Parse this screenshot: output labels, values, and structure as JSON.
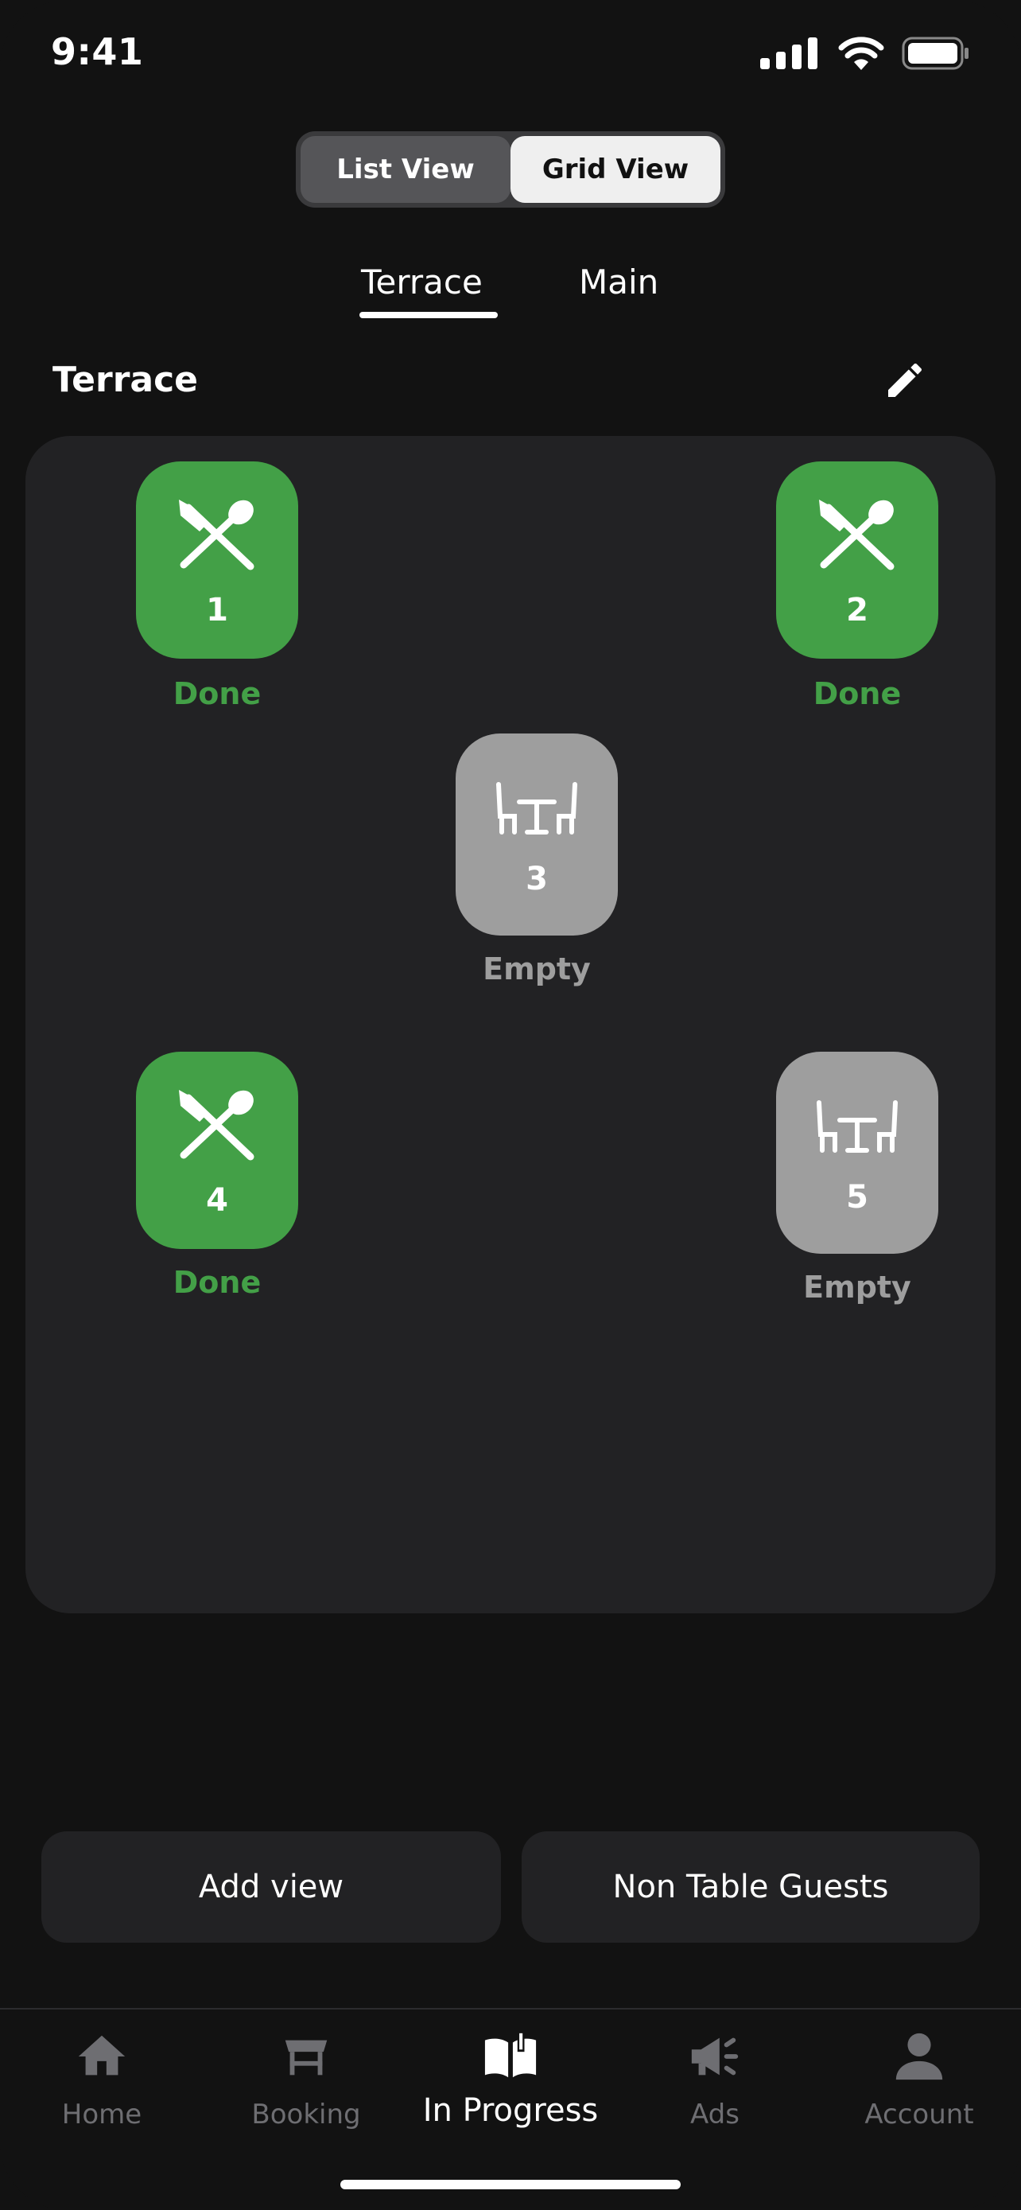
{
  "status_bar": {
    "time": "9:41"
  },
  "view_toggle": {
    "list_label": "List View",
    "grid_label": "Grid View",
    "selected": "Grid View"
  },
  "tabs": [
    {
      "label": "Terrace",
      "active": true
    },
    {
      "label": "Main",
      "active": false
    }
  ],
  "section": {
    "title": "Terrace"
  },
  "tables": [
    {
      "number": "1",
      "status": "Done",
      "state": "done"
    },
    {
      "number": "2",
      "status": "Done",
      "state": "done"
    },
    {
      "number": "3",
      "status": "Empty",
      "state": "empty"
    },
    {
      "number": "4",
      "status": "Done",
      "state": "done"
    },
    {
      "number": "5",
      "status": "Empty",
      "state": "empty"
    }
  ],
  "actions": {
    "add_view": "Add view",
    "non_table_guests": "Non Table Guests"
  },
  "nav": [
    {
      "label": "Home",
      "icon": "home-icon"
    },
    {
      "label": "Booking",
      "icon": "table-icon"
    },
    {
      "label": "In Progress",
      "icon": "open-book-icon",
      "active": true
    },
    {
      "label": "Ads",
      "icon": "megaphone-icon"
    },
    {
      "label": "Account",
      "icon": "person-icon"
    }
  ],
  "colors": {
    "done": "#43a047",
    "empty": "#9e9e9e",
    "background": "#121212",
    "card": "#222224"
  }
}
